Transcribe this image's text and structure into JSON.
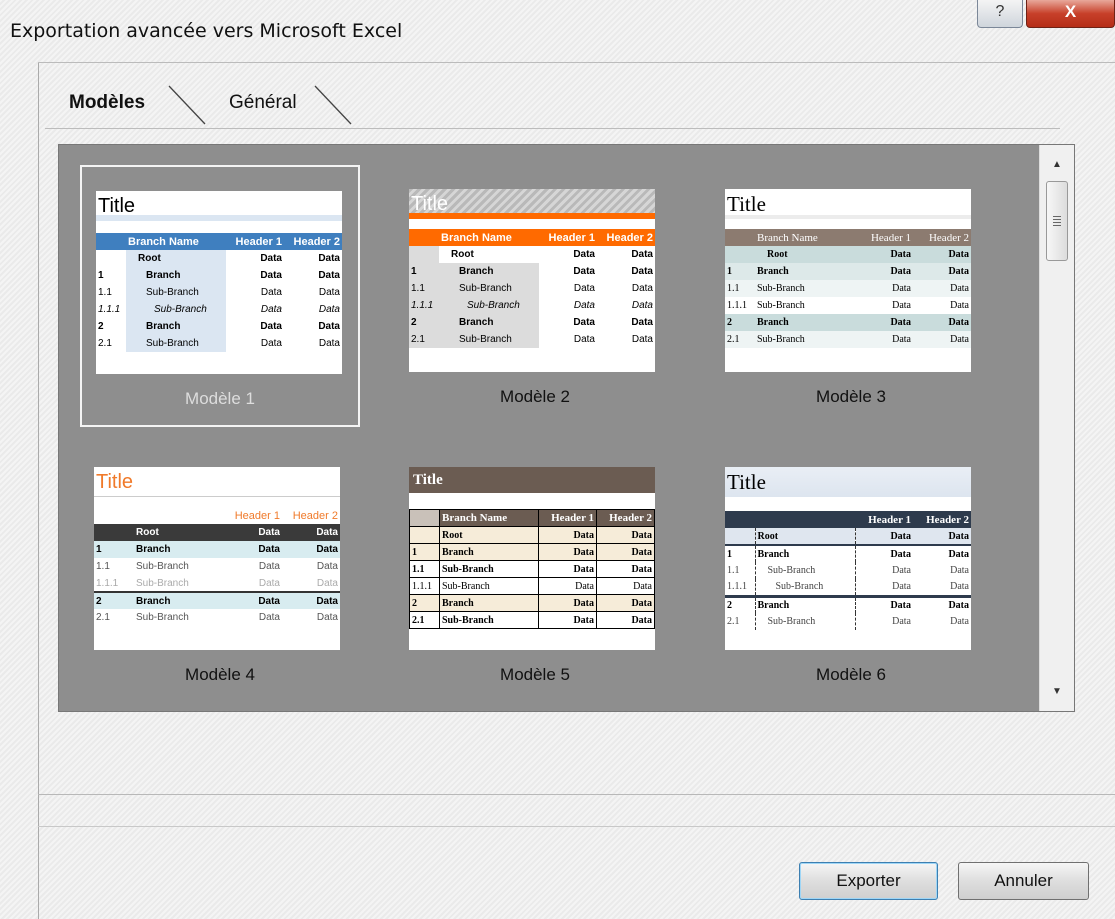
{
  "window": {
    "title": "Exportation avancée vers Microsoft Excel",
    "help_glyph": "?",
    "close_glyph": "X"
  },
  "tabs": [
    {
      "label": "Modèles"
    },
    {
      "label": "Général"
    }
  ],
  "templates": [
    {
      "label": "Modèle 1",
      "title": "Title",
      "headers": [
        "Branch Name",
        "Header 1",
        "Header 2"
      ],
      "rows": [
        {
          "num": "",
          "name": "Root",
          "d1": "Data",
          "d2": "Data"
        },
        {
          "num": "1",
          "name": "Branch",
          "d1": "Data",
          "d2": "Data"
        },
        {
          "num": "1.1",
          "name": "Sub-Branch",
          "d1": "Data",
          "d2": "Data"
        },
        {
          "num": "1.1.1",
          "name": "Sub-Branch",
          "d1": "Data",
          "d2": "Data"
        },
        {
          "num": "2",
          "name": "Branch",
          "d1": "Data",
          "d2": "Data"
        },
        {
          "num": "2.1",
          "name": "Sub-Branch",
          "d1": "Data",
          "d2": "Data"
        }
      ]
    },
    {
      "label": "Modèle 2",
      "title": "Title",
      "headers": [
        "Branch Name",
        "Header 1",
        "Header 2"
      ],
      "rows": [
        {
          "num": "",
          "name": "Root",
          "d1": "Data",
          "d2": "Data"
        },
        {
          "num": "1",
          "name": "Branch",
          "d1": "Data",
          "d2": "Data"
        },
        {
          "num": "1.1",
          "name": "Sub-Branch",
          "d1": "Data",
          "d2": "Data"
        },
        {
          "num": "1.1.1",
          "name": "Sub-Branch",
          "d1": "Data",
          "d2": "Data"
        },
        {
          "num": "2",
          "name": "Branch",
          "d1": "Data",
          "d2": "Data"
        },
        {
          "num": "2.1",
          "name": "Sub-Branch",
          "d1": "Data",
          "d2": "Data"
        }
      ]
    },
    {
      "label": "Modèle 3",
      "title": "Title",
      "headers": [
        "Branch Name",
        "Header 1",
        "Header 2"
      ],
      "rows": [
        {
          "num": "",
          "name": "Root",
          "d1": "Data",
          "d2": "Data"
        },
        {
          "num": "1",
          "name": "Branch",
          "d1": "Data",
          "d2": "Data"
        },
        {
          "num": "1.1",
          "name": "Sub-Branch",
          "d1": "Data",
          "d2": "Data"
        },
        {
          "num": "1.1.1",
          "name": "Sub-Branch",
          "d1": "Data",
          "d2": "Data"
        },
        {
          "num": "2",
          "name": "Branch",
          "d1": "Data",
          "d2": "Data"
        },
        {
          "num": "2.1",
          "name": "Sub-Branch",
          "d1": "Data",
          "d2": "Data"
        }
      ]
    },
    {
      "label": "Modèle 4",
      "title": "Title",
      "headers": [
        "",
        "Header 1",
        "Header 2"
      ],
      "rows": [
        {
          "num": "",
          "name": "Root",
          "d1": "Data",
          "d2": "Data"
        },
        {
          "num": "1",
          "name": "Branch",
          "d1": "Data",
          "d2": "Data"
        },
        {
          "num": "1.1",
          "name": "Sub-Branch",
          "d1": "Data",
          "d2": "Data"
        },
        {
          "num": "1.1.1",
          "name": "Sub-Branch",
          "d1": "Data",
          "d2": "Data"
        },
        {
          "num": "2",
          "name": "Branch",
          "d1": "Data",
          "d2": "Data"
        },
        {
          "num": "2.1",
          "name": "Sub-Branch",
          "d1": "Data",
          "d2": "Data"
        }
      ]
    },
    {
      "label": "Modèle 5",
      "title": "Title",
      "headers": [
        "Branch Name",
        "Header 1",
        "Header 2"
      ],
      "rows": [
        {
          "num": "",
          "name": "Root",
          "d1": "Data",
          "d2": "Data"
        },
        {
          "num": "1",
          "name": "Branch",
          "d1": "Data",
          "d2": "Data"
        },
        {
          "num": "1.1",
          "name": "Sub-Branch",
          "d1": "Data",
          "d2": "Data"
        },
        {
          "num": "1.1.1",
          "name": "Sub-Branch",
          "d1": "Data",
          "d2": "Data"
        },
        {
          "num": "2",
          "name": "Branch",
          "d1": "Data",
          "d2": "Data"
        },
        {
          "num": "2.1",
          "name": "Sub-Branch",
          "d1": "Data",
          "d2": "Data"
        }
      ]
    },
    {
      "label": "Modèle 6",
      "title": "Title",
      "headers": [
        "",
        "Header 1",
        "Header 2"
      ],
      "rows": [
        {
          "num": "",
          "name": "Root",
          "d1": "Data",
          "d2": "Data"
        },
        {
          "num": "1",
          "name": "Branch",
          "d1": "Data",
          "d2": "Data"
        },
        {
          "num": "1.1",
          "name": "Sub-Branch",
          "d1": "Data",
          "d2": "Data"
        },
        {
          "num": "1.1.1",
          "name": "Sub-Branch",
          "d1": "Data",
          "d2": "Data"
        },
        {
          "num": "2",
          "name": "Branch",
          "d1": "Data",
          "d2": "Data"
        },
        {
          "num": "2.1",
          "name": "Sub-Branch",
          "d1": "Data",
          "d2": "Data"
        }
      ]
    }
  ],
  "buttons": {
    "export_label": "Exporter",
    "cancel_label": "Annuler"
  },
  "colors": {
    "gallery_bg": "#8e8e8e",
    "model2_accent": "#ff6a00",
    "model1_accent": "#3f7fbf"
  }
}
